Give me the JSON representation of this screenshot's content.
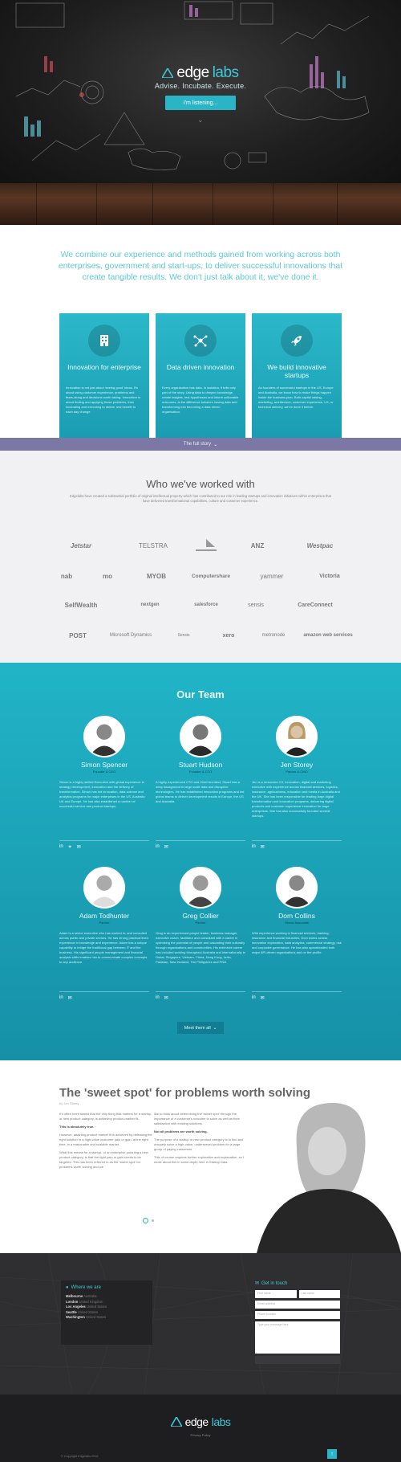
{
  "brand": {
    "word1": "edge",
    "word2": "labs",
    "accent": "#2bb3c6"
  },
  "hero": {
    "tagline": "Advise. Incubate. Execute.",
    "cta": "I'm listening..."
  },
  "intro": {
    "text": "We combine our experience and methods gained from working across both enterprises, government and start-ups, to deliver successful innovations that create tangible results. We don't just talk about it, we've done it."
  },
  "features": [
    {
      "icon": "building-icon",
      "title": "Innovation for enterprise",
      "text": "Innovation is not just about 'seeing good' ideas. It's about using customer experience, problems and fears-along and decisions worth taking. Innovation is about finding and applying those problems, then incubating and executing to deliver real benefit to each day change."
    },
    {
      "icon": "network-icon",
      "title": "Data driven innovation",
      "text": "Every organisation has data. In isolation, it tells only part of the story. Using data to deepen knowledge, create insights, test hypotheses and inform actionable outcomes, is the difference between having data and transforming into becoming a data driven organisation."
    },
    {
      "icon": "rocket-icon",
      "title": "We build innovative startups",
      "text": "As founders of successful startups in the US, Europe and Australia, we know how to make things happen inside the business plan. Both capital raising, marketing, architecture, customer experience, UX, or technical delivery, we've done it before."
    }
  ],
  "story_bar": {
    "label": "The full story"
  },
  "clients": {
    "title": "Who we've worked with",
    "subtitle": "Edgelabs have created a substantial portfolio of original intellectual property which has contributed to our role in leading startups and innovation initiatives within enterprises that have delivered transformational capabilities, culture and customer experience.",
    "logos": [
      "Jetstar",
      "TELSTRA",
      "",
      "ANZ",
      "Westpac",
      "nab",
      "mo",
      "MYOB",
      "Computershare",
      "yammer",
      "Victoria",
      "SelfWealth",
      "nextgen",
      "salesforce",
      "sensis",
      "CareConnect",
      "POST",
      "Microsoft Dynamics",
      "Sensis",
      "xero",
      "metronode",
      "amazon web services"
    ]
  },
  "team": {
    "title": "Our Team",
    "members": [
      {
        "name": "Simon Spencer",
        "role": "Founder & CEO",
        "bio": "Simon is a highly skilled Executive with global experience in strategy development, innovation and the delivery of transformation. Simon has led innovation, data science and analytics programs for major enterprises in the US, Australia UK and Europe. He has also established a number of successful service and product startups."
      },
      {
        "name": "Stuart Hudson",
        "role": "Founder & CTO",
        "bio": "A highly experienced CTO and Chief Architect, Stuart has a deep background in large scale data and disruptive technologies. He has established innovation programs and led global teams to deliver development results in Europe, the US and Australia."
      },
      {
        "name": "Jen Storey",
        "role": "Partner & CMO",
        "bio": "Jen is a renowned CX, innovation, digital and marketing executive with experience across financial services, logistics, insurance, agribusiness, education and media in Australia and the UK. She has been responsible for leading large digital transformation and innovation programs, delivering digital products and customer experience innovation for large enterprises. She has also successfully founded several startups."
      },
      {
        "name": "Adam Todhunter",
        "role": "Partner",
        "bio": "Adam is a senior executive who has worked in, and consulted across public and private sectors. He has strong practical lived experience in knowledge and experience. Adam has a unique capability to bridge the traditional gap between IT and the business. His significant people management and financial analysis skills enables him to communicate complex concepts to any audience."
      },
      {
        "name": "Greg Collier",
        "role": "Partner",
        "bio": "Greg is an experienced people leader, business manager, executive coach, facilitator and consultant with a career in optimising the potential of people and cascading their culturally through organisations and communities. His extensive career has included working throughout Australia and internationally in Dubai, Singapore, Vietnam, China, Hong Kong, India, Pakistan, New Zealand, The Philippines and PNG."
      },
      {
        "name": "Dom Collins",
        "role": "Senior Associate",
        "bio": "With experience working in financial services, banking, insurance and financial industries, Dom works across innovation exploration, data analytics, commercial strategy, risk and corporate governance. He has also spearheaded both major API-driven organisations and on the profile."
      }
    ],
    "meet_btn": "Meet them all"
  },
  "blog": {
    "title": "The 'sweet spot' for problems worth solving",
    "author": "by Jen Storey",
    "col1": [
      {
        "bold": false,
        "text": "It's often been stated that the only thing that matters for a startup, or new product category, is achieving product-market fit."
      },
      {
        "bold": true,
        "text": "This is absolutely true."
      },
      {
        "bold": false,
        "text": "However, attaining product market fit is achieved by defeating the right solution to a high-value customer pain or gain, at the right time, in a reasonable and scalable market."
      },
      {
        "bold": false,
        "text": "What this means for a startup, or an enterprise pursuing a new product category, is that the right pain or gain needs to be targeted. This has been referred to as the 'sweet spot' for problems worth solving and we"
      }
    ],
    "col2": [
      {
        "bold": false,
        "text": "like to think about determining the 'sweet spot' through the importance of a customer's outcome to solve as well as their satisfaction with existing solutions."
      },
      {
        "bold": true,
        "text": "Not all problems are worth solving."
      },
      {
        "bold": false,
        "text": "The purpose of a startup or new product category is to find and uniquely solve a high-value, underserved problem for a large group of paying customers."
      },
      {
        "bold": false,
        "text": "This of course requires further exploration and explanation, so I wrote about this in some depth here in Startup Data."
      }
    ]
  },
  "contact": {
    "offices_title": "Where we are",
    "offices": [
      {
        "city": "Melbourne",
        "country": "Australia"
      },
      {
        "city": "London",
        "country": "United Kingdom"
      },
      {
        "city": "Los Angeles",
        "country": "United States"
      },
      {
        "city": "Seattle",
        "country": "United States"
      },
      {
        "city": "Washington",
        "country": "United States"
      }
    ],
    "form_title": "Get in touch",
    "fields": {
      "first": "First name",
      "last": "Last name",
      "email": "Email address",
      "phone": "Phone number",
      "message": "Type your message here"
    }
  },
  "footer": {
    "small": "Privacy Policy",
    "copyright": "© Copyright Edgelabs 2016"
  }
}
